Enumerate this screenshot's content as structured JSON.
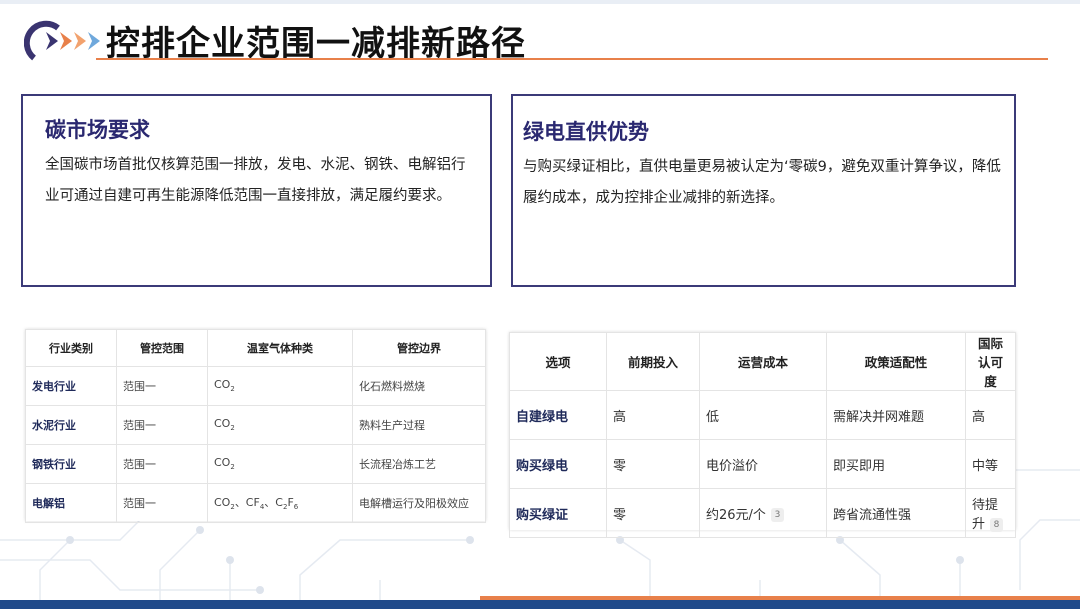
{
  "header": {
    "title": "控排企业范围一减排新路径"
  },
  "colors": {
    "accent_orange": "#e8804a",
    "box_border": "#3b3a78",
    "heading_blue": "#2a2870",
    "bottom_blue": "#1f4a8a"
  },
  "left_box": {
    "heading": "碳市场要求",
    "text": "全国碳市场首批仅核算范围一排放，发电、水泥、钢铁、电解铝行业可通过自建可再生能源降低范围一直接排放，满足履约要求。"
  },
  "right_box": {
    "heading": "绿电直供优势",
    "text": "与购买绿证相比，直供电量更易被认定为‘零碳9，避免双重计算争议，降低履约成本，成为控排企业减排的新选择。"
  },
  "industry_table": {
    "headers": [
      "行业类别",
      "管控范围",
      "温室气体种类",
      "管控边界"
    ],
    "rows": [
      {
        "industry": "发电行业",
        "scope": "范围一",
        "gas": "CO",
        "gas_sub": "2",
        "boundary": "化石燃料燃烧"
      },
      {
        "industry": "水泥行业",
        "scope": "范围一",
        "gas": "CO",
        "gas_sub": "2",
        "boundary": "熟料生产过程"
      },
      {
        "industry": "钢铁行业",
        "scope": "范围一",
        "gas": "CO",
        "gas_sub": "2",
        "boundary": "长流程冶炼工艺"
      },
      {
        "industry": "电解铝",
        "scope": "范围一",
        "gas_parts": [
          "CO",
          "2",
          "、CF",
          "4",
          "、C",
          "2",
          "F",
          "6"
        ],
        "boundary": "电解槽运行及阳极效应"
      }
    ]
  },
  "option_table": {
    "headers": [
      "选项",
      "前期投入",
      "运营成本",
      "政策适配性",
      "国际认可度"
    ],
    "rows": [
      {
        "option": "自建绿电",
        "investment": "高",
        "op_cost": "低",
        "policy": "需解决并网难题",
        "recognition": "高",
        "cost_cite": "",
        "recog_cite": ""
      },
      {
        "option": "购买绿电",
        "investment": "零",
        "op_cost": "电价溢价",
        "policy": "即买即用",
        "recognition": "中等",
        "cost_cite": "",
        "recog_cite": ""
      },
      {
        "option": "购买绿证",
        "investment": "零",
        "op_cost": "约26元/个",
        "policy": "跨省流通性强",
        "recognition": "待提升",
        "cost_cite": "3",
        "recog_cite": "8"
      }
    ]
  }
}
